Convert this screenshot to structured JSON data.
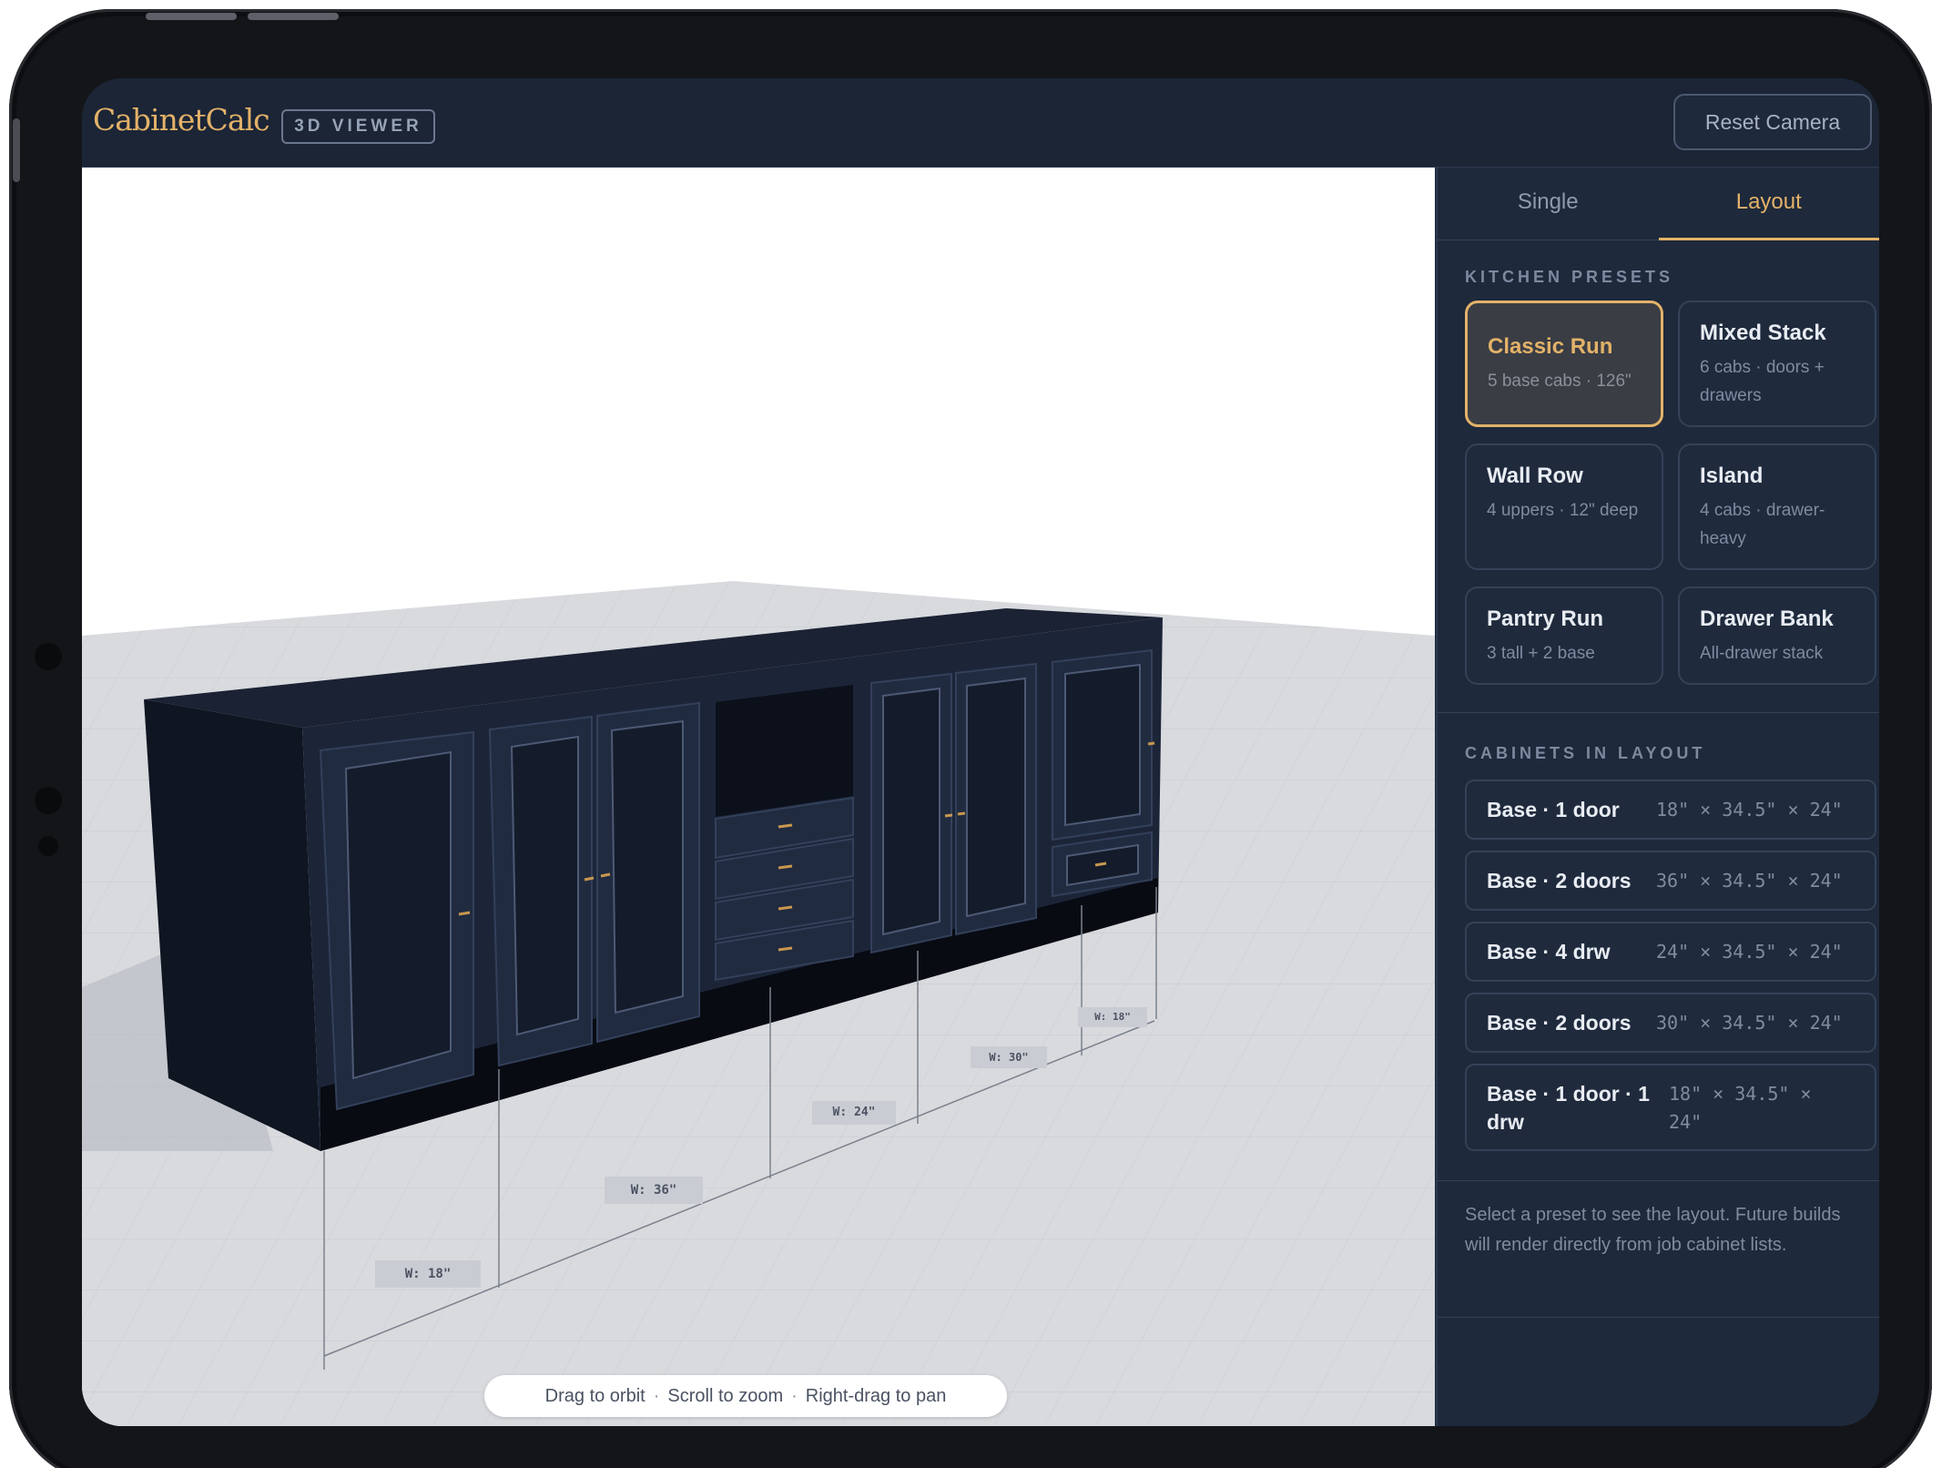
{
  "app": {
    "logo": "CabinetCalc",
    "badge": "3D VIEWER",
    "reset_camera_label": "Reset Camera"
  },
  "tabs": [
    {
      "label": "Single",
      "active": false
    },
    {
      "label": "Layout",
      "active": true
    }
  ],
  "kitchen_presets": {
    "heading": "KITCHEN PRESETS",
    "items": [
      {
        "name": "Classic Run",
        "desc": "5 base cabs · 126\"",
        "selected": true
      },
      {
        "name": "Mixed Stack",
        "desc": "6 cabs · doors + drawers",
        "selected": false
      },
      {
        "name": "Wall Row",
        "desc": "4 uppers · 12\" deep",
        "selected": false
      },
      {
        "name": "Island",
        "desc": "4 cabs · drawer-heavy",
        "selected": false
      },
      {
        "name": "Pantry Run",
        "desc": "3 tall + 2 base",
        "selected": false
      },
      {
        "name": "Drawer Bank",
        "desc": "All-drawer stack",
        "selected": false
      }
    ]
  },
  "cabinets_in_layout": {
    "heading": "CABINETS IN LAYOUT",
    "items": [
      {
        "name": "Base · 1 door",
        "dims": "18\" × 34.5\" × 24\""
      },
      {
        "name": "Base · 2 doors",
        "dims": "36\" × 34.5\" × 24\""
      },
      {
        "name": "Base · 4 drw",
        "dims": "24\" × 34.5\" × 24\""
      },
      {
        "name": "Base · 2 doors",
        "dims": "30\" × 34.5\" × 24\""
      },
      {
        "name": "Base · 1 door · 1 drw",
        "dims": "18\" × 34.5\" × 24\""
      }
    ]
  },
  "footnote": "Select a preset to see the layout. Future builds will render directly from job cabinet lists.",
  "viewport": {
    "dimension_labels": [
      "W: 18\"",
      "W: 36\"",
      "W: 24\"",
      "W: 30\"",
      "W: 18\""
    ],
    "hint": {
      "orbit": "Drag to orbit",
      "zoom": "Scroll to zoom",
      "pan": "Right-drag to pan",
      "separator": "·"
    }
  },
  "colors": {
    "accent": "#e3b269",
    "header_bg": "#1b2536",
    "sidebar_bg": "#1e293b",
    "cabinet_navy": "#1b2436",
    "floor": "#d9dbdf"
  }
}
